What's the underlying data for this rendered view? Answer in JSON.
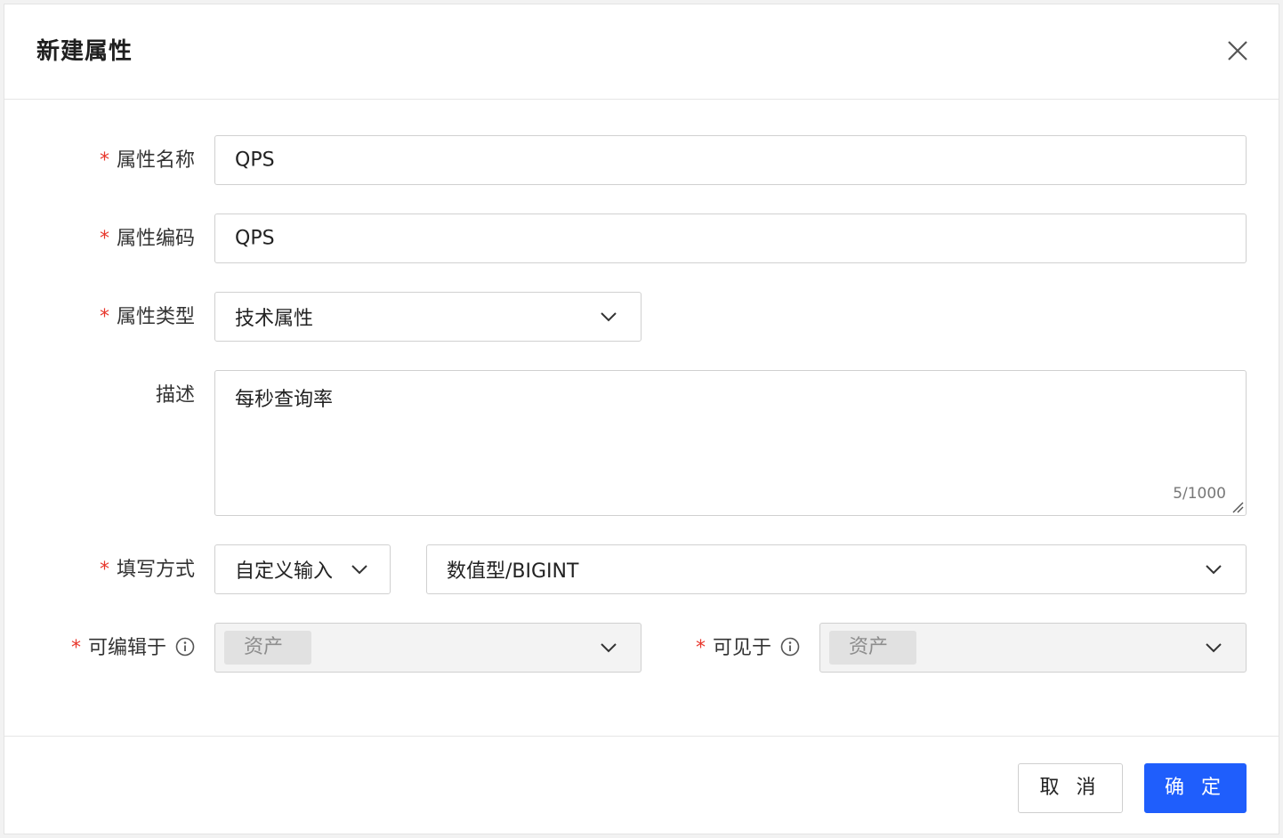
{
  "dialog": {
    "title": "新建属性",
    "close_icon": "close-icon"
  },
  "form": {
    "required_mark": "*",
    "name": {
      "label": "属性名称",
      "value": "QPS"
    },
    "code": {
      "label": "属性编码",
      "value": "QPS"
    },
    "type": {
      "label": "属性类型",
      "value": "技术属性"
    },
    "description": {
      "label": "描述",
      "value": "每秒查询率",
      "counter": "5/1000"
    },
    "fill_method": {
      "label": "填写方式",
      "mode": "自定义输入",
      "data_type": "数值型/BIGINT"
    },
    "editable_in": {
      "label": "可编辑于",
      "tag": "资产"
    },
    "visible_in": {
      "label": "可见于",
      "tag": "资产"
    }
  },
  "footer": {
    "cancel_label": "取 消",
    "ok_label": "确 定"
  },
  "colors": {
    "primary": "#1f5efc",
    "required": "#e8372c"
  }
}
